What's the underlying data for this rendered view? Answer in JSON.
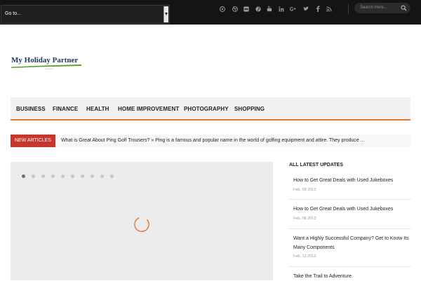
{
  "topbar": {
    "goto_label": "Go to...",
    "social_icons": [
      "github-icon",
      "dribbble-icon",
      "flickr-icon",
      "pinterest-icon",
      "youtube-icon",
      "linkedin-icon",
      "google-plus-icon",
      "twitter-icon",
      "facebook-icon",
      "rss-icon"
    ],
    "search_placeholder": "Search Here..."
  },
  "logo": {
    "text": "My Holiday Partner"
  },
  "nav": {
    "items": [
      "BUSINESS",
      "FINANCE",
      "HEALTH",
      "HOME IMPROVEMENT",
      "PHOTOGRAPHY",
      "SHOPPING"
    ]
  },
  "ticker": {
    "badge": "NEW ARTICLES",
    "text": "What is Great About Ping Golf Trousers? » Ping is a famous and popular name in the world of golfing equipment and attire. They produce ..."
  },
  "slider": {
    "dot_count": 10,
    "active_dot": 1
  },
  "sidebar": {
    "title": "ALL LATEST UPDATES",
    "posts": [
      {
        "title": "How to Get Great Deals with Used Jukeboxes",
        "date": "Feb, 08 2013"
      },
      {
        "title": "How to Get Great Deals with Used Jukeboxes",
        "date": "Feb, 08 2013"
      },
      {
        "title": "Want a Highly Successful Company? Get to Know Its Many Components",
        "date": "Feb, 12 2013"
      },
      {
        "title": "Take the Trail to Adventure",
        "date": ""
      }
    ]
  },
  "colors": {
    "accent": "#e07a30",
    "badge": "#c8352b",
    "topbar": "#141414"
  }
}
